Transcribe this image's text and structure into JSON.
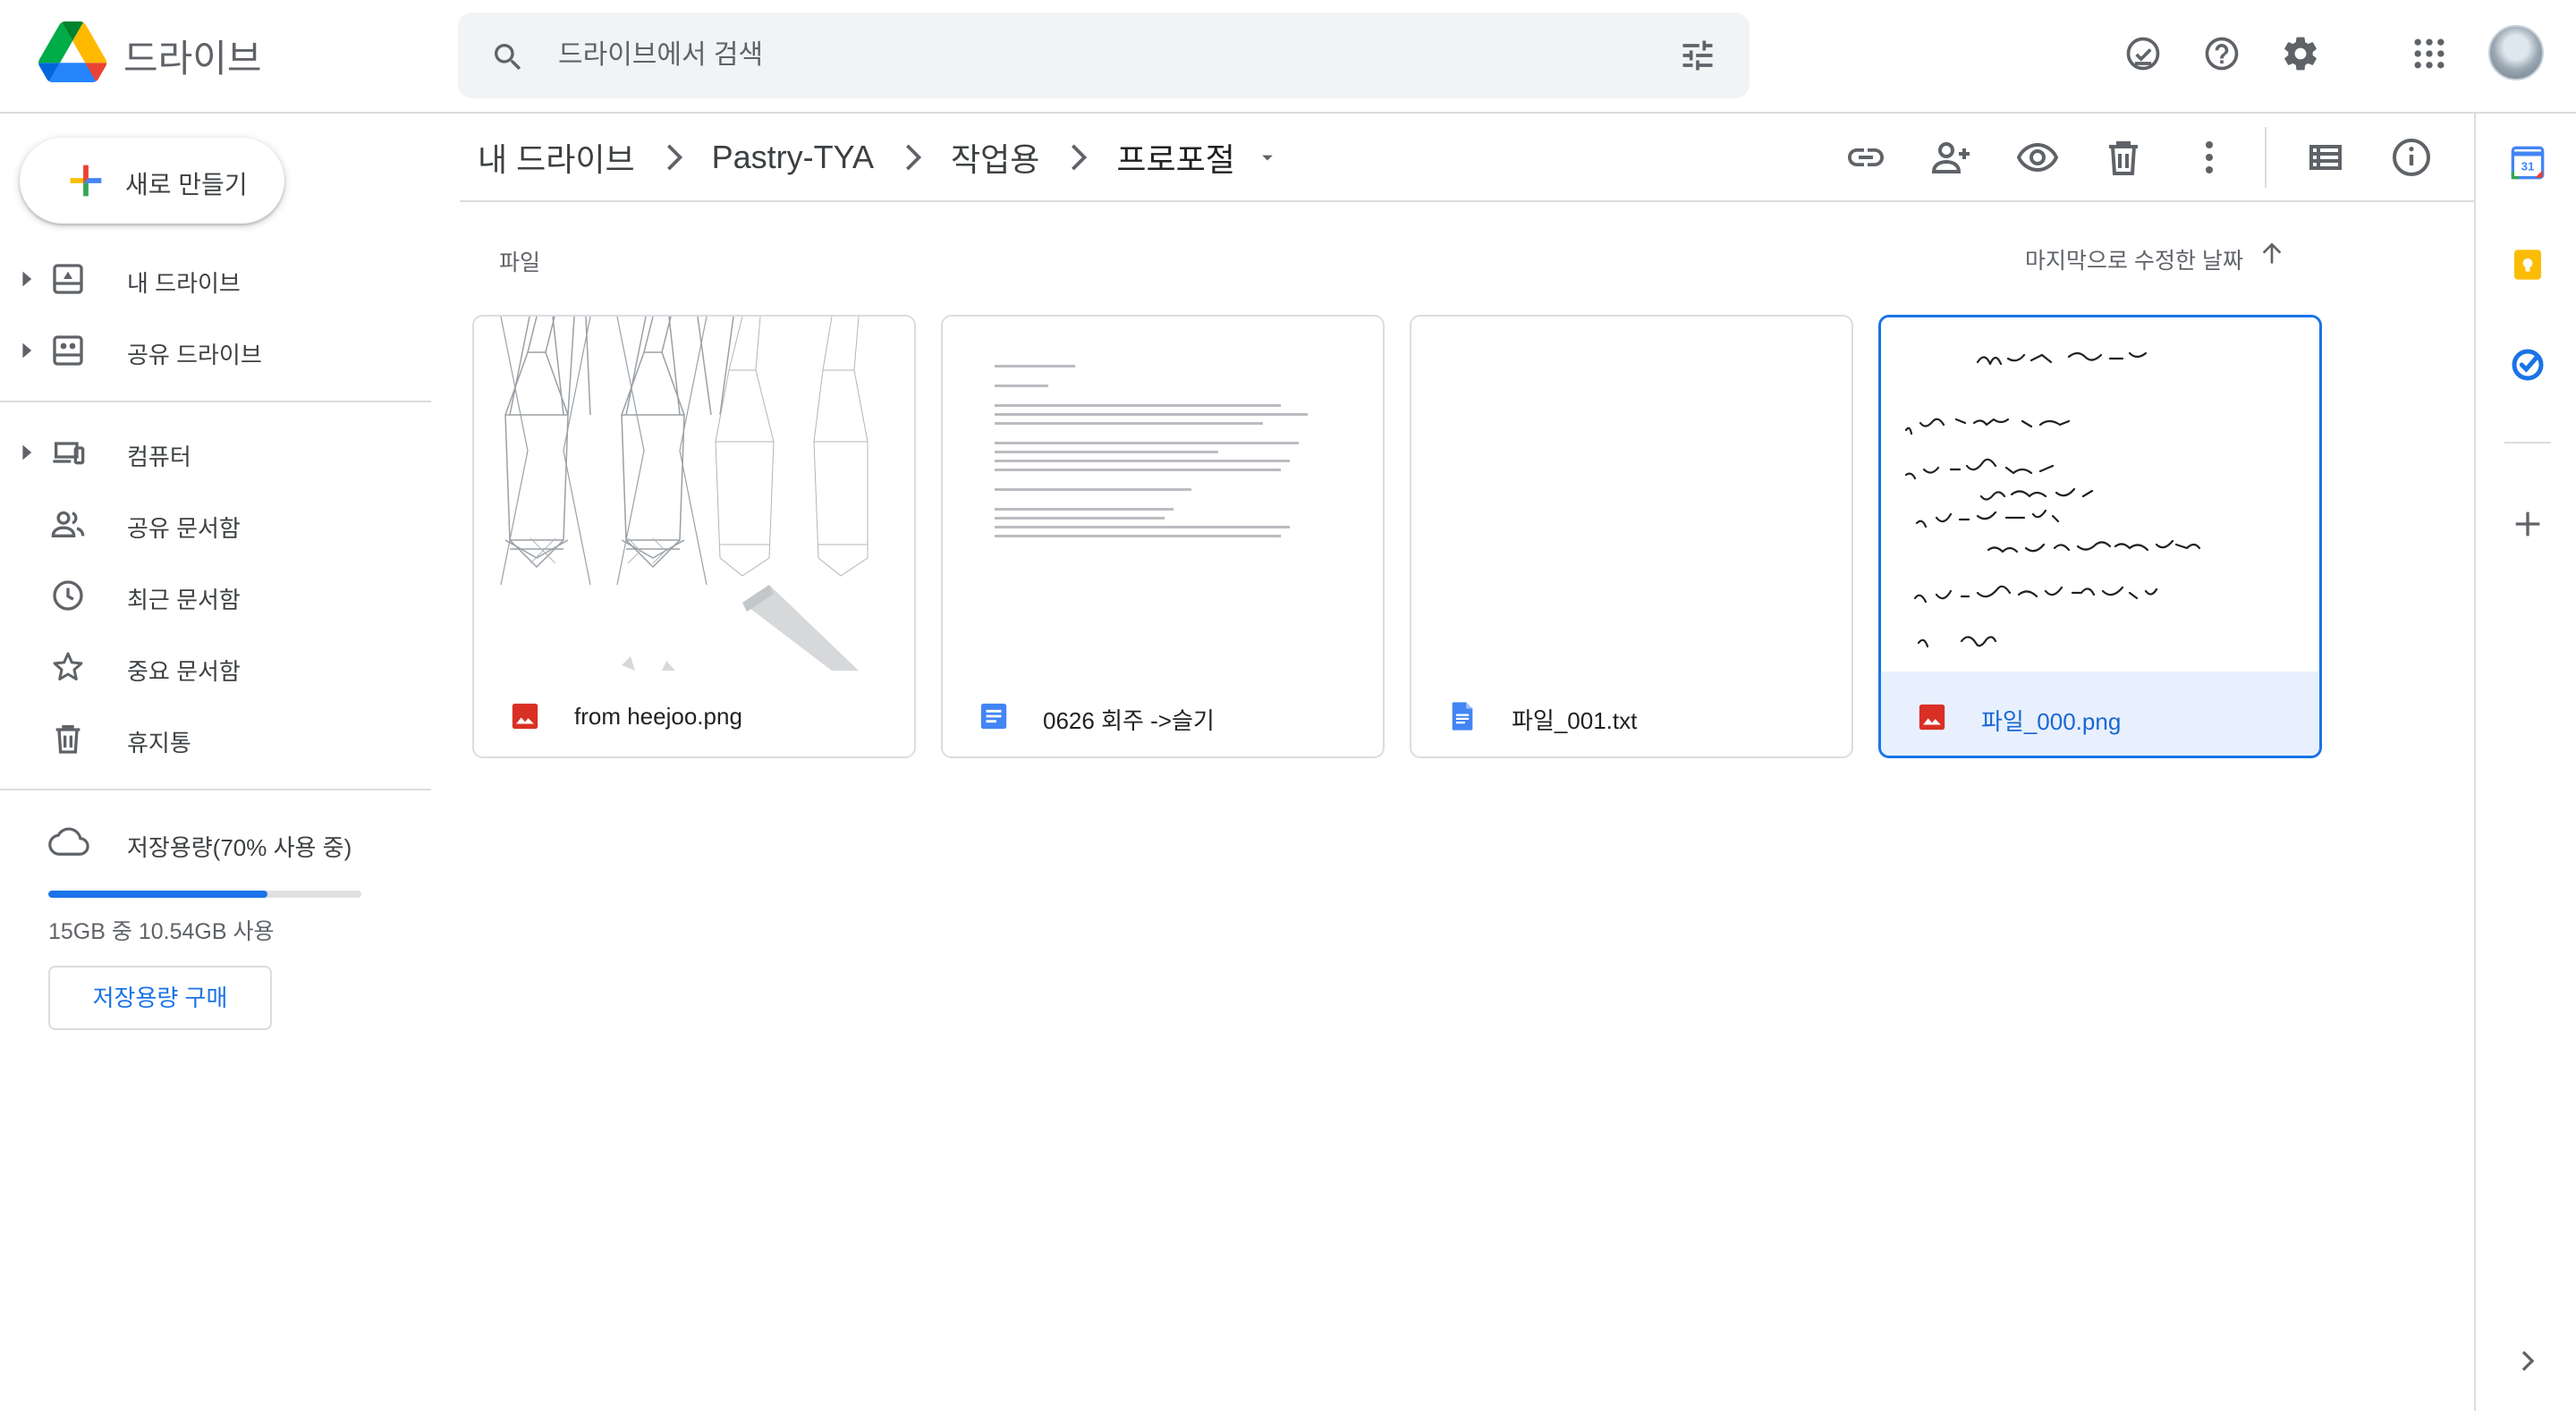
{
  "app": {
    "name": "드라이브"
  },
  "search": {
    "placeholder": "드라이브에서 검색"
  },
  "header_icons": [
    "ready-for-offline-icon",
    "help-icon",
    "settings-icon",
    "apps-grid-icon",
    "avatar"
  ],
  "sidebar": {
    "new_label": "새로 만들기",
    "items": [
      {
        "label": "내 드라이브",
        "icon": "my-drive-icon",
        "expandable": true
      },
      {
        "label": "공유 드라이브",
        "icon": "shared-drives-icon",
        "expandable": true
      },
      {
        "label": "컴퓨터",
        "icon": "computers-icon",
        "expandable": true
      },
      {
        "label": "공유 문서함",
        "icon": "shared-with-me-icon",
        "expandable": false
      },
      {
        "label": "최근 문서함",
        "icon": "recent-icon",
        "expandable": false
      },
      {
        "label": "중요 문서함",
        "icon": "starred-icon",
        "expandable": false
      },
      {
        "label": "휴지통",
        "icon": "trash-icon",
        "expandable": false
      }
    ],
    "storage": {
      "label": "저장용량(70% 사용 중)",
      "used_fraction": 0.7,
      "detail": "15GB 중 10.54GB 사용",
      "buy_label": "저장용량 구매"
    }
  },
  "breadcrumb": [
    "내 드라이브",
    "Pastry-TYA",
    "작업용",
    "프로포절"
  ],
  "toolbar_icons": [
    "link-icon",
    "share-icon",
    "preview-icon",
    "delete-icon",
    "more-icon",
    "list-view-icon",
    "info-icon"
  ],
  "main": {
    "section_label": "파일",
    "sort_label": "마지막으로 수정한 날짜",
    "files": [
      {
        "name": "from heejoo.png",
        "type": "image",
        "selected": false
      },
      {
        "name": "0626 회주 ->슬기",
        "type": "doc",
        "selected": false
      },
      {
        "name": "파일_001.txt",
        "type": "text",
        "selected": false
      },
      {
        "name": "파일_000.png",
        "type": "image",
        "selected": true
      }
    ]
  },
  "side_panel_icons": [
    "calendar-icon",
    "keep-icon",
    "tasks-icon",
    "add-icon",
    "expand-icon"
  ],
  "colors": {
    "accent": "#1a73e8",
    "selected_bg": "#e8f0fe",
    "image_icon": "#d93025",
    "doc_icon": "#4285f4",
    "keep": "#fbbc04"
  }
}
